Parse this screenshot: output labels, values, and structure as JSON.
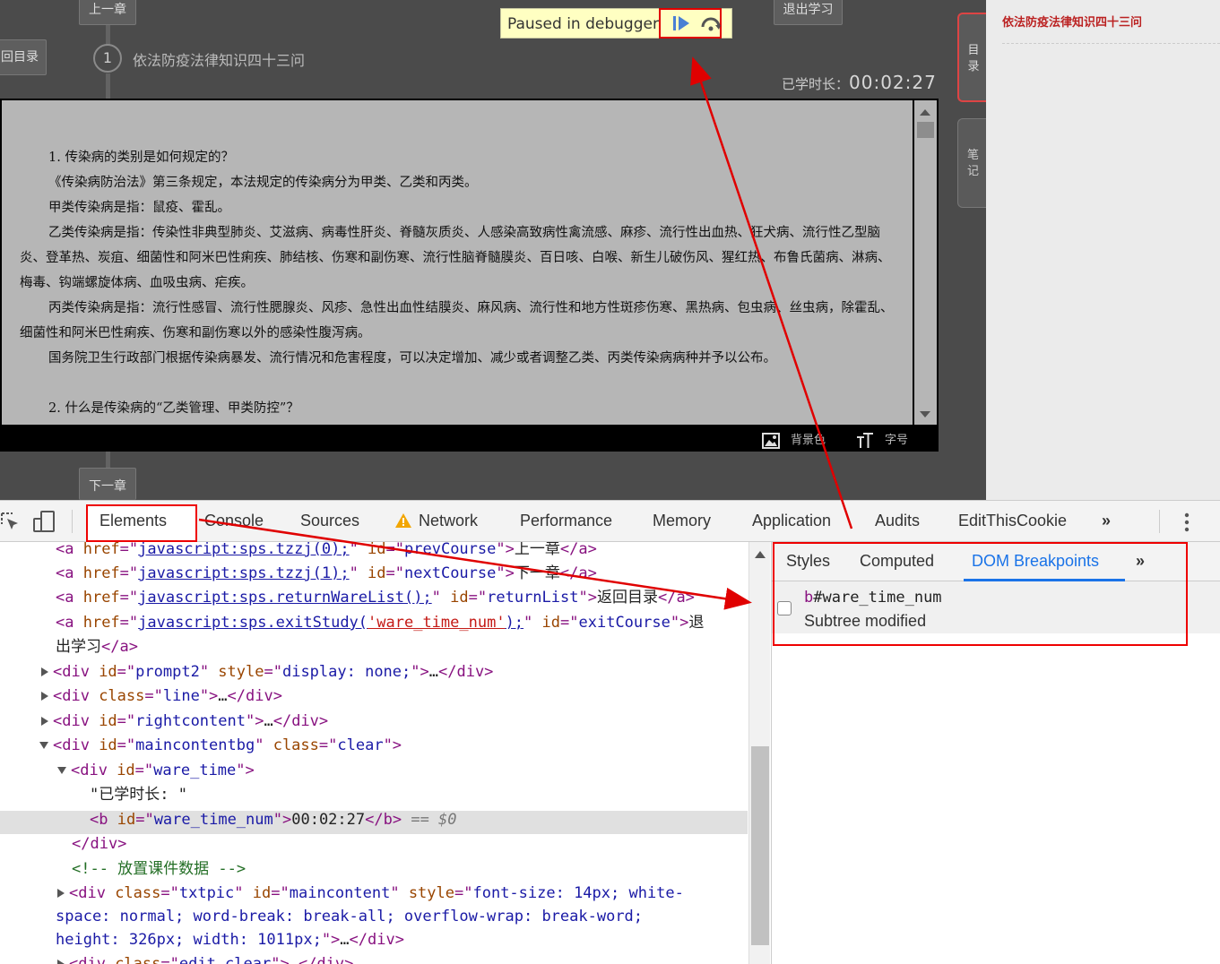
{
  "course": {
    "prev_chapter": "上一章",
    "next_chapter": "下一章",
    "exit_study": "退出学习",
    "return_list": "回目录",
    "chapter_number": "1",
    "chapter_title": "依法防疫法律知识四十三问",
    "study_time_label": "已学时长：",
    "study_time_value": "00:02:27",
    "debugger_text": "Paused in debugger",
    "debugger_resume_icon": "resume-icon",
    "debugger_stepover_icon": "step-over-icon",
    "content": {
      "p1": "1. 传染病的类别是如何规定的？",
      "p2": "《传染病防治法》第三条规定，本法规定的传染病分为甲类、乙类和丙类。",
      "p3": "甲类传染病是指：鼠疫、霍乱。",
      "p4": "乙类传染病是指：传染性非典型肺炎、艾滋病、病毒性肝炎、脊髓灰质炎、人感染高致病性禽流感、麻疹、流行性出血热、狂犬病、流行性乙型脑炎、登革热、炭疽、细菌性和阿米巴性痢疾、肺结核、伤寒和副伤寒、流行性脑脊髓膜炎、百日咳、白喉、新生儿破伤风、猩红热、布鲁氏菌病、淋病、梅毒、钩端螺旋体病、血吸虫病、疟疾。",
      "p5": "丙类传染病是指：流行性感冒、流行性腮腺炎、风疹、急性出血性结膜炎、麻风病、流行性和地方性斑疹伤寒、黑热病、包虫病、丝虫病，除霍乱、细菌性和阿米巴性痢疾、伤寒和副伤寒以外的感染性腹泻病。",
      "p6": "国务院卫生行政部门根据传染病暴发、流行情况和危害程度，可以决定增加、减少或者调整乙类、丙类传染病病种并予以公布。",
      "p7": "2. 什么是传染病的“乙类管理、甲类防控”？"
    },
    "toolbar": {
      "bg_color": "背景色",
      "font_size": "字号"
    },
    "side_tabs": {
      "catalog_1": "目",
      "catalog_2": "录",
      "notes_1": "笔",
      "notes_2": "记"
    },
    "right_panel_title": "依法防疫法律知识四十三问"
  },
  "devtools": {
    "tabs": [
      "Elements",
      "Console",
      "Sources",
      "Network",
      "Performance",
      "Memory",
      "Application",
      "Audits",
      "EditThisCookie"
    ],
    "more_tabs": "»",
    "side_tabs": [
      "Styles",
      "Computed",
      "DOM Breakpoints"
    ],
    "side_more": "»",
    "breakpoint": {
      "node_tag": "b",
      "node_id": "#ware_time_num",
      "type": "Subtree modified"
    },
    "dom": {
      "a_prev_href": "javascript:sps.tzzj(0);",
      "a_prev_id": "prevCourse",
      "a_prev_text": "上一章",
      "a_next_href": "javascript:sps.tzzj(1);",
      "a_next_id": "nextCourse",
      "a_next_text": "下一章",
      "a_return_href": "javascript:sps.returnWareList();",
      "a_return_id": "returnList",
      "a_return_text": "返回目录",
      "a_exit_href_1": "javascript:sps.exitStudy(",
      "a_exit_href_str": "'ware_time_num'",
      "a_exit_href_2": ");",
      "a_exit_id": "exitCourse",
      "a_exit_text_1": "退",
      "a_exit_text_2": "出学习",
      "div_prompt2_id": "prompt2",
      "div_prompt2_style": "display: none;",
      "div_line_class": "line",
      "div_right_id": "rightcontent",
      "div_main_id": "maincontentbg",
      "div_main_class": "clear",
      "div_ware_id": "ware_time",
      "text_label": "\"已学时长: \"",
      "b_id": "ware_time_num",
      "b_text": "00:02:27",
      "selected_marker": "== $0",
      "comment": "<!-- 放置课件数据 -->",
      "div_txt_class": "txtpic",
      "div_txt_id": "maincontent",
      "div_txt_style_1": "font-size: 14px; white-",
      "div_txt_style_2": "space: normal; word-break: break-all; overflow-wrap: break-word;",
      "div_txt_style_3": "height: 326px; width: 1011px;",
      "div_last_class": "edit clear"
    }
  },
  "colors": {
    "annotation_red": "#e00000",
    "active_tab_blue": "#1a73e8",
    "debugger_bg": "#ffffc2"
  }
}
